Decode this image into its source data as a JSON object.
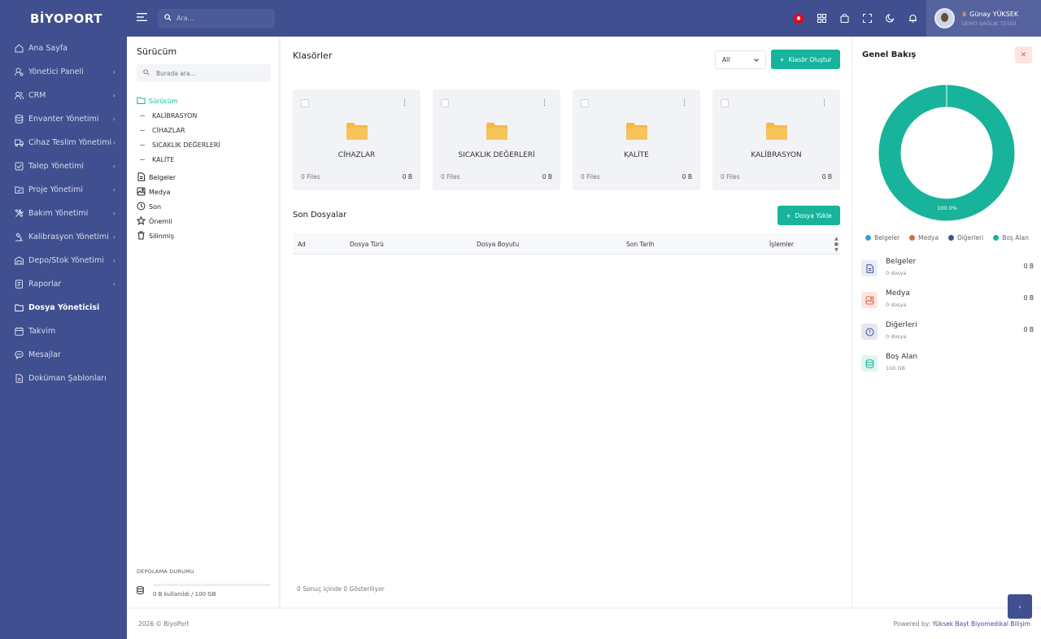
{
  "brand": "BİYOPORT",
  "sidebar": {
    "items": [
      {
        "label": "Ana Sayfa",
        "icon": "home-icon",
        "chevron": false
      },
      {
        "label": "Yönetici Paneli",
        "icon": "user-cog-icon",
        "chevron": true
      },
      {
        "label": "CRM",
        "icon": "users-icon",
        "chevron": true
      },
      {
        "label": "Envanter Yönetimi",
        "icon": "database-icon",
        "chevron": true
      },
      {
        "label": "Cihaz Teslim Yönetimi",
        "icon": "truck-icon",
        "chevron": true
      },
      {
        "label": "Talep Yönetimi",
        "icon": "checkbox-icon",
        "chevron": true
      },
      {
        "label": "Proje Yönetimi",
        "icon": "folder-check-icon",
        "chevron": true
      },
      {
        "label": "Bakım Yönetimi",
        "icon": "tools-icon",
        "chevron": true
      },
      {
        "label": "Kalibrasyon Yönetimi",
        "icon": "microscope-icon",
        "chevron": true
      },
      {
        "label": "Depo/Stok Yönetimi",
        "icon": "warehouse-icon",
        "chevron": true
      },
      {
        "label": "Raporlar",
        "icon": "report-icon",
        "chevron": true
      },
      {
        "label": "Dosya Yöneticisi",
        "icon": "folder-icon",
        "chevron": false,
        "active": true
      },
      {
        "label": "Takvim",
        "icon": "calendar-icon",
        "chevron": false
      },
      {
        "label": "Mesajlar",
        "icon": "message-icon",
        "chevron": false
      },
      {
        "label": "Doküman Şablonları",
        "icon": "document-icon",
        "chevron": false
      }
    ]
  },
  "topbar": {
    "search_placeholder": "Ara...",
    "user_name": "Günay YÜKSEK",
    "user_org": "DEMO SAĞLIK TESİSİ"
  },
  "drive": {
    "title": "Sürücüm",
    "search_placeholder": "Burada ara...",
    "root": "Sürücüm",
    "folders": [
      "KALİBRASYON",
      "CİHAZLAR",
      "SICAKLIK DEĞERLERİ",
      "KALİTE"
    ],
    "sections": [
      {
        "label": "Belgeler",
        "icon": "document-icon"
      },
      {
        "label": "Medya",
        "icon": "image-icon"
      },
      {
        "label": "Son",
        "icon": "clock-icon"
      },
      {
        "label": "Önemli",
        "icon": "star-icon"
      },
      {
        "label": "Silinmiş",
        "icon": "trash-icon"
      }
    ],
    "storage_title": "DEPOLAMA DURUMU",
    "storage_text": "0 B kullanıldı / 100 GB",
    "storage_used_fraction": 0
  },
  "main": {
    "folders_title": "Klasörler",
    "filter_value": "All",
    "create_button": "Klasör Oluştur",
    "folder_cards": [
      {
        "name": "CİHAZLAR",
        "files": "0 Files",
        "size": "0 B"
      },
      {
        "name": "SICAKLIK DEĞERLERİ",
        "files": "0 Files",
        "size": "0 B"
      },
      {
        "name": "KALİTE",
        "files": "0 Files",
        "size": "0 B"
      },
      {
        "name": "KALİBRASYON",
        "files": "0 Files",
        "size": "0 B"
      }
    ],
    "recent_title": "Son Dosyalar",
    "upload_button": "Dosya Yükle",
    "table_headers": [
      "Ad",
      "Dosya Türü",
      "Dosya Boyutu",
      "Son Tarih",
      "İşlemler"
    ],
    "results_text": "0 Sonuç içinde 0 Gösteriliyor"
  },
  "overview": {
    "title": "Genel Bakış",
    "chart_data": {
      "type": "pie",
      "categories": [
        "Belgeler",
        "Medya",
        "Diğerleri",
        "Boş Alan"
      ],
      "values": [
        0,
        0,
        0,
        100
      ],
      "colors": [
        "#3b9dd8",
        "#e2664a",
        "#3f4f8f",
        "#17b39a"
      ],
      "data_label": "100.0%"
    },
    "stats": [
      {
        "name": "Belgeler",
        "sub": "0 dosya",
        "size": "0 B",
        "icon": "document-icon",
        "bg": "#e7ecf8",
        "fg": "#3f4f8f"
      },
      {
        "name": "Medya",
        "sub": "0 dosya",
        "size": "0 B",
        "icon": "image-icon",
        "bg": "#fde6e1",
        "fg": "#e2664a"
      },
      {
        "name": "Diğerleri",
        "sub": "0 dosya",
        "size": "0 B",
        "icon": "info-icon",
        "bg": "#e4e7f2",
        "fg": "#3f4f8f"
      },
      {
        "name": "Boş Alan",
        "sub": "100 GB",
        "size": "",
        "icon": "database-icon",
        "bg": "#dff5f0",
        "fg": "#17b39a"
      }
    ]
  },
  "footer": {
    "copyright": "2026 © BiyoPort",
    "powered_prefix": "Powered by:",
    "powered_company": "Yüksek Bayt Biyomedikal Bilişim"
  }
}
